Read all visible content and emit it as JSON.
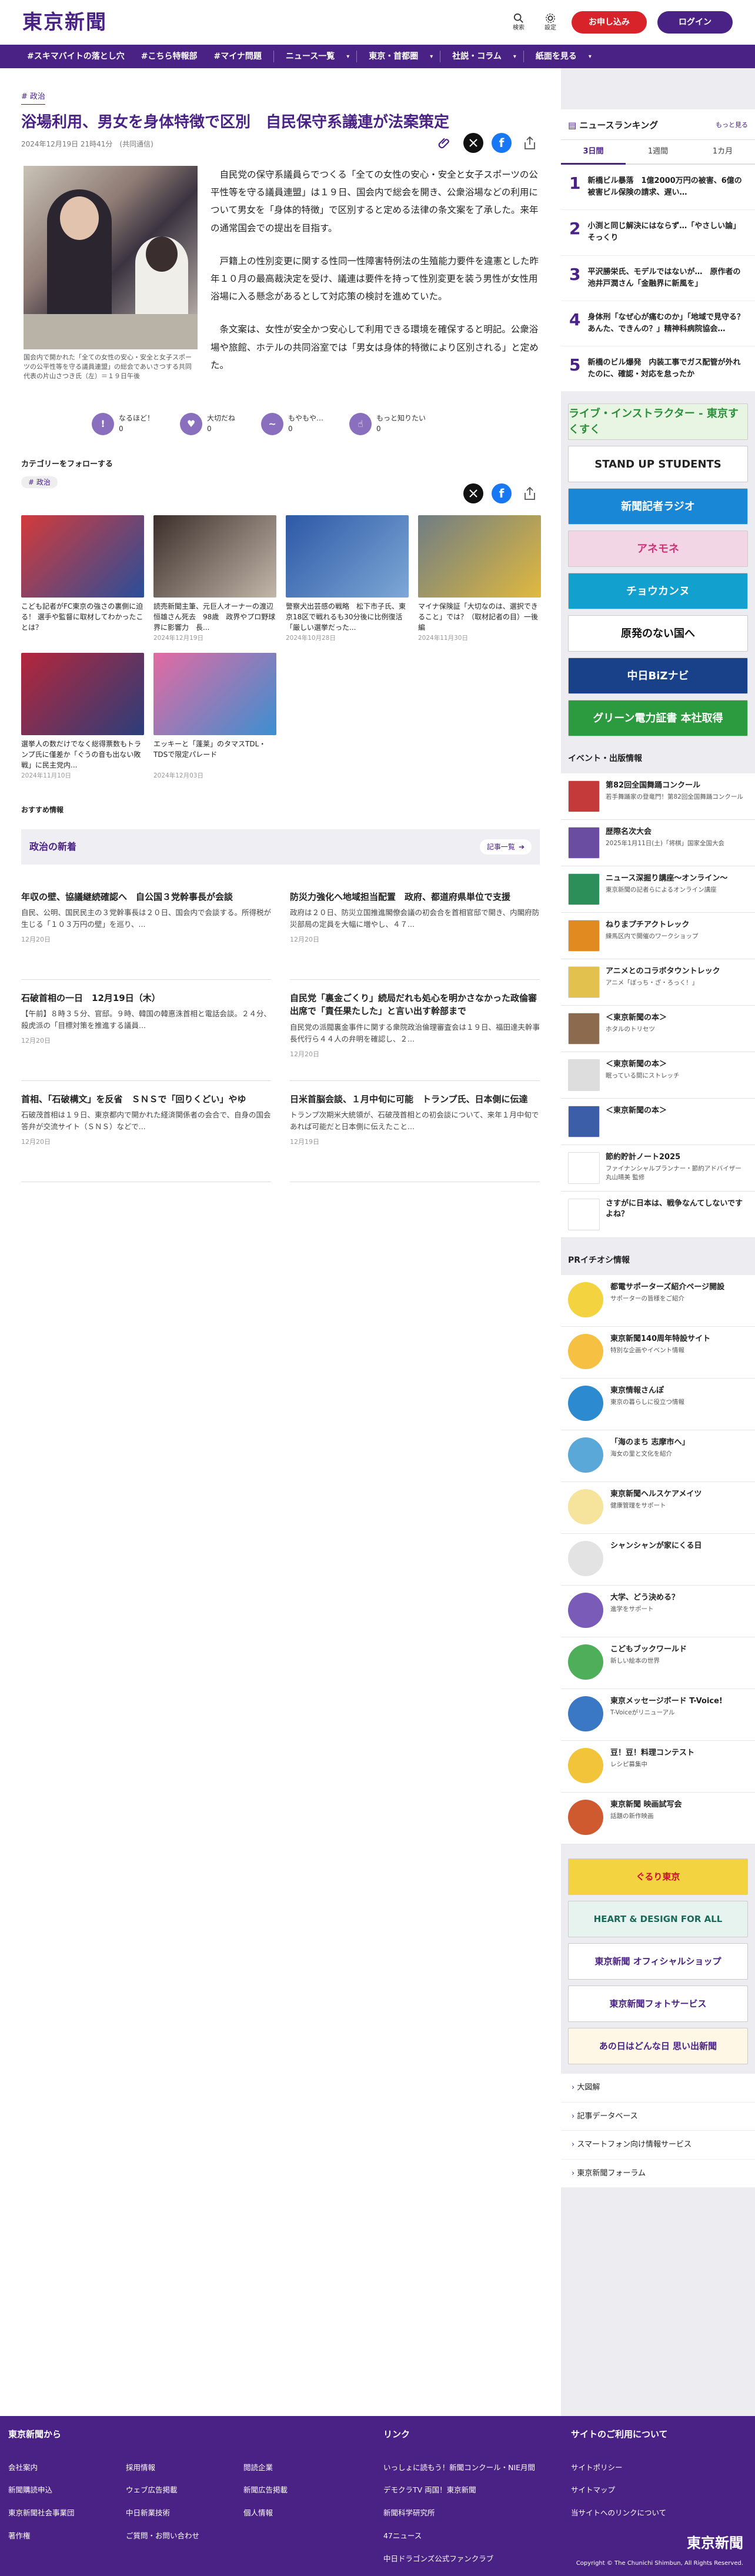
{
  "header": {
    "logo": "東京新聞",
    "search": "検索",
    "settings": "設定",
    "subscribe": "お申し込み",
    "login": "ログイン"
  },
  "nav": [
    "#スキマバイトの落とし穴",
    "#こちら特報部",
    "#マイナ問題",
    "ニュース一覧",
    "東京・首都圏",
    "社説・コラム",
    "紙面を見る"
  ],
  "article": {
    "category": "政治",
    "title": "浴場利用、男女を身体特徴で区別　自民保守系議連が法案策定",
    "date": "2024年12月19日 21時41分　(共同通信)",
    "caption": "国会内で開かれた「全ての女性の安心・安全と女子スポーツの公平性等を守る議員連盟」の総会であいさつする共同代表の片山さつき氏（左）＝１９日午後",
    "paragraphs": [
      "自民党の保守系議員らでつくる「全ての女性の安心・安全と女子スポーツの公平性等を守る議員連盟」は１９日、国会内で総会を開き、公衆浴場などの利用について男女を「身体的特徴」で区別すると定める法律の条文案を了承した。来年の通常国会での提出を目指す。",
      "戸籍上の性別変更に関する性同一性障害特例法の生殖能力要件を違憲とした昨年１０月の最高裁決定を受け、議連は要件を持って性別変更を装う男性が女性用浴場に入る懸念があるとして対応策の検討を進めていた。",
      "条文案は、女性が安全かつ安心して利用できる環境を確保すると明記。公衆浴場や旅館、ホテルの共同浴室では「男女は身体的特徴により区別される」と定めた。"
    ]
  },
  "reactions": [
    {
      "label": "なるほど！",
      "count": "0"
    },
    {
      "label": "大切だね",
      "count": "0"
    },
    {
      "label": "もやもや…",
      "count": "0"
    },
    {
      "label": "もっと知りたい",
      "count": "0"
    }
  ],
  "follow": {
    "label": "カテゴリーをフォローする",
    "tag": "# 政治"
  },
  "related": [
    {
      "title": "こども記者がFC東京の強さの裏側に迫る！ 選手や監督に取材してわかったことは？",
      "date": "",
      "color1": "#d43a3a",
      "color2": "#2a4e9a"
    },
    {
      "title": "読売新聞主筆、元巨人オーナーの渡辺恒雄さん死去　98歳　政界やプロ野球界に影響力　長...",
      "date": "2024年12月19日",
      "color1": "#3b2e2a",
      "color2": "#c3b7aa"
    },
    {
      "title": "警察犬出芸感の戦略　松下市子氏、東京18区で戦れるも30分後に比例復活「厳しい選挙だった...",
      "date": "2024年10月28日",
      "color1": "#2d58a6",
      "color2": "#7da8d6"
    },
    {
      "title": "マイナ保険証「大切なのは、選択できること」では？（取材記者の目）一後編",
      "date": "2024年11月30日",
      "color1": "#6f7d84",
      "color2": "#e0b93f"
    },
    {
      "title": "選挙人の数だけでなく総得票数もトランプ氏に僅差か「ぐうの音も出ない敗戦」に民主党内...",
      "date": "2024年11月10日",
      "color1": "#b5263b",
      "color2": "#2b3e7a"
    },
    {
      "title": "エッキーと「蓬莱」のタマスTDL・TDSで限定パレード",
      "date": "2024年12月03日",
      "color1": "#e46aa2",
      "color2": "#3c8fd1"
    }
  ],
  "recommend": "おすすめ情報",
  "politics": {
    "header": "政治の新着",
    "more": "記事一覧",
    "items": [
      {
        "headline": "年収の壁、協議継続確認へ　自公国３党幹事長が会談",
        "desc": "自民、公明、国民民主の３党幹事長は２０日、国会内で会談する。所得税が生じる「１０３万円の壁」を巡り、...",
        "date": "12月20日"
      },
      {
        "headline": "防災力強化へ地域担当配置　政府、都道府県単位で支援",
        "desc": "政府は２０日、防災立国推進閣僚会議の初会合を首相官邸で開き、内閣府防災部局の定員を大幅に増やし、４７...",
        "date": "12月20日"
      },
      {
        "headline": "石破首相の一日　12月19日（木）",
        "desc": "【午前】８時３５分、官邸。９時、韓国の韓悳洙首相と電話会談。２４分、殺虎派の「目標対策を推進する議員...",
        "date": "12月20日"
      },
      {
        "headline": "自民党「裏金ごくり」続局だれも処心を明かさなかった政倫審出席で「責任果たした」と言い出す幹部まで",
        "desc": "自民党の派閥裏金事件に関する衆院政治倫理審査会は１９日、福田達夫幹事長代行ら４４人の弁明を確認し、２...",
        "date": "12月20日"
      },
      {
        "headline": "首相、「石破構文」を反省　ＳＮＳで「回りくどい」やゆ",
        "desc": "石破茂首相は１９日、東京都内で開かれた経済関係者の会合で、自身の国会答弁が交流サイト（ＳＮＳ）などで...",
        "date": "12月20日"
      },
      {
        "headline": "日米首脳会談、１月中旬に可能　トランプ氏、日本側に伝達",
        "desc": "トランプ次期米大統領が、石破茂首相との初会談について、来年１月中旬であれば可能だと日本側に伝えたこと...",
        "date": "12月19日"
      }
    ]
  },
  "ranking": {
    "title": "ニュースランキング",
    "more": "もっと見る",
    "tabs": [
      "3日間",
      "1週間",
      "1カ月"
    ],
    "items": [
      {
        "n": "1",
        "t": "新橋ビル暴落　1億2000万円の被害、6億の被害ビル保険の請求、遅い…"
      },
      {
        "n": "2",
        "t": "小渕と同じ解決にはならず…「やさしい論」そっくり"
      },
      {
        "n": "3",
        "t": "平沢勝栄氏、モデルではないが…　原作者の池井戸潤さん「金融界に新風を」"
      },
      {
        "n": "4",
        "t": "身体刑「なぜ心が痛むのか」「地域で見守る？あんた、できんの？」精神科病院協会…"
      },
      {
        "n": "5",
        "t": "新橋のビル爆発　内装工事でガス配管が外れたのに、確認・対応を怠ったか"
      }
    ]
  },
  "banners": [
    "ライブ・インストラクター - 東京すくすく",
    "STAND UP STUDENTS",
    "新聞記者ラジオ",
    "アネモネ",
    "チョウカンヌ",
    "原発のない国へ",
    "中日BiZナビ",
    "グリーン電力証書 本社取得"
  ],
  "events": {
    "title": "イベント・出版情報",
    "items": [
      {
        "t": "第82回全国舞踊コンクール",
        "s": "若手舞踊家の登竜門！第82回全国舞踊コンクール",
        "c": "#c43a3a"
      },
      {
        "t": "歴際名次大会",
        "s": "2025年1月11日(土)「将棋」国家全国大会",
        "c": "#6a4ca0"
      },
      {
        "t": "ニュース深掘り講座～オンライン～",
        "s": "東京新聞の記者らによるオンライン講座",
        "c": "#2c8f5a"
      },
      {
        "t": "ねりまプチアクトレック",
        "s": "練馬区内で開催のワークショップ",
        "c": "#e08a1f"
      },
      {
        "t": "アニメとのコラボタウントレック",
        "s": "アニメ「ぼっち・ざ・ろっく！」",
        "c": "#e3c14f"
      },
      {
        "t": "＜東京新聞の本＞",
        "s": "ホタルのトリセツ",
        "c": "#8c6a4d"
      },
      {
        "t": "＜東京新聞の本＞",
        "s": "眠っている間にストレッチ",
        "c": "#ddd"
      },
      {
        "t": "＜東京新聞の本＞",
        "s": "",
        "c": "#3c5da8"
      },
      {
        "t": "節約貯計ノート2025",
        "s": "ファイナンシャルプランナー・節約アドバイザー 丸山晴美 監修",
        "c": "#fff"
      },
      {
        "t": "さすがに日本は、戦争なんてしないですよね？",
        "s": "",
        "c": "#fff"
      }
    ]
  },
  "pr": {
    "title": "PRイチオシ情報",
    "items": [
      {
        "t": "都電サポーターズ紹介ページ開設",
        "s": "サポーターの皆様をご紹介",
        "c": "#f3d33f"
      },
      {
        "t": "東京新聞140周年特設サイト",
        "s": "特別な企画やイベント情報",
        "c": "#f6c142"
      },
      {
        "t": "東京情報さんぽ",
        "s": "東京の暮らしに役立つ情報",
        "c": "#2c8ad0"
      },
      {
        "t": "「海のまち 志摩市へ」",
        "s": "海女の里と文化を紹介",
        "c": "#5aa8d8"
      },
      {
        "t": "東京新聞ヘルスケアメイツ",
        "s": "健康管理をサポート",
        "c": "#f6e39c"
      },
      {
        "t": "シャンシャンが家にくる日",
        "s": "",
        "c": "#e3e3e3"
      },
      {
        "t": "大学、どう決める？",
        "s": "進学をサポート",
        "c": "#7a5bb8"
      },
      {
        "t": "こどもブックワールド",
        "s": "新しい絵本の世界",
        "c": "#4fae5a"
      },
      {
        "t": "東京メッセージボード T-Voice!",
        "s": "T-Voiceがリニューアル",
        "c": "#3a78c6"
      },
      {
        "t": "豆！豆！料理コンテスト",
        "s": "レシピ募集中",
        "c": "#f1c43a"
      },
      {
        "t": "東京新聞 映画試写会",
        "s": "話題の新作映画",
        "c": "#d05a2f"
      }
    ]
  },
  "banners2": [
    "ぐるり東京",
    "HEART & DESIGN FOR ALL",
    "東京新聞 オフィシャルショップ",
    "東京新聞フォトサービス",
    "あの日はどんな日 思い出新聞"
  ],
  "side_links": [
    "大図解",
    "記事データベース",
    "スマートフォン向け情報サービス",
    "東京新聞フォーラム"
  ],
  "footer": {
    "col1": {
      "title": "東京新聞から",
      "items": [
        "会社案内",
        "新聞購読申込",
        "東京新聞社会事業団",
        "著作権",
        "採用情報",
        "ウェブ広告掲載",
        "中日新業技術",
        "ご質問・お問い合わせ",
        "閲読企業",
        "新聞広告掲載",
        "個人情報"
      ]
    },
    "col2": {
      "title": "リンク",
      "items": [
        "いっしょに読もう！新聞コンクール・NIE月間",
        "デモクラTV 両国！東京新聞",
        "新聞科学研究所",
        "47ニュース",
        "中日ドラゴンズ公式ファンクラブ"
      ]
    },
    "col3": {
      "title": "サイトのご利用について",
      "items": [
        "サイトポリシー",
        "サイトマップ",
        "当サイトへのリンクについて"
      ]
    },
    "logo": "東京新聞",
    "copyright": "Copyright © The Chunichi Shimbun, All Rights Reserved."
  }
}
